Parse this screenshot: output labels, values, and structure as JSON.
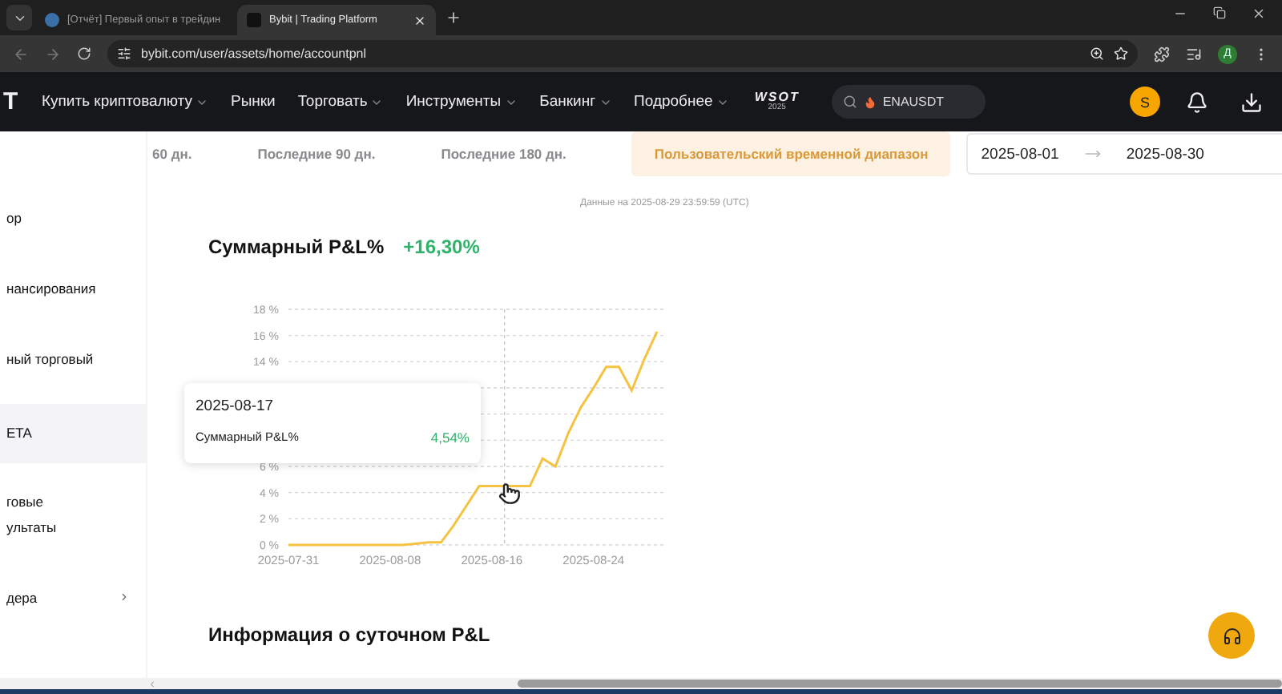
{
  "browser": {
    "tabs": [
      {
        "title": "[Отчёт] Первый опыт в трейдин",
        "selected": false
      },
      {
        "title": "Bybit | Trading Platform",
        "selected": true
      }
    ],
    "url": "bybit.com/user/assets/home/accountpnl",
    "profile_initial": "Д"
  },
  "nav": {
    "logo": "T",
    "items": [
      {
        "label": "Купить криптовалюту",
        "dropdown": true
      },
      {
        "label": "Рынки",
        "dropdown": false
      },
      {
        "label": "Торговать",
        "dropdown": true
      },
      {
        "label": "Инструменты",
        "dropdown": true
      },
      {
        "label": "Банкинг",
        "dropdown": true
      },
      {
        "label": "Подробнее",
        "dropdown": true
      }
    ],
    "event_logo": {
      "title": "WSOT",
      "year": "2025"
    },
    "search": {
      "value": "ENAUSDT"
    },
    "avatar": "S"
  },
  "sidebar": {
    "items": [
      {
        "label": "ор",
        "selected": false
      },
      {
        "label": "нансирования",
        "selected": false
      },
      {
        "label": "ный торговый",
        "selected": false
      },
      {
        "label": "ETA",
        "selected": true
      },
      {
        "label": "говые\nультаты",
        "selected": false
      },
      {
        "label": "дера",
        "selected": false,
        "chevron": true
      }
    ]
  },
  "periods": [
    {
      "label": "60 дн.",
      "selected": false
    },
    {
      "label": "Последние 90 дн.",
      "selected": false
    },
    {
      "label": "Последние 180 дн.",
      "selected": false
    },
    {
      "label": "Пользовательский временной диапазон",
      "selected": true
    }
  ],
  "date_range": {
    "start": "2025-08-01",
    "end": "2025-08-30"
  },
  "timestamp": "Данные на 2025-08-29 23:59:59 (UTC)",
  "summary": {
    "title": "Суммарный P&L%",
    "value": "+16,30%"
  },
  "chart_data": {
    "type": "line",
    "grid": true,
    "categories": [
      "2025-07-31",
      null,
      null,
      null,
      null,
      null,
      null,
      null,
      "2025-08-08",
      null,
      null,
      null,
      null,
      null,
      null,
      null,
      "2025-08-16",
      null,
      null,
      null,
      null,
      null,
      null,
      null,
      "2025-08-24",
      null,
      null,
      null,
      null,
      null
    ],
    "series": [
      {
        "color": "#f5c242",
        "values": [
          0,
          0,
          0,
          0,
          0,
          0,
          0,
          0,
          0,
          0,
          0.1,
          0.2,
          0.2,
          1.5,
          3,
          4.5,
          4.5,
          4.5,
          4.5,
          4.5,
          6.6,
          6,
          8.5,
          10.5,
          12,
          13.6,
          13.6,
          11.8,
          14.2,
          16.3
        ]
      }
    ],
    "ylim": [
      0,
      18
    ],
    "yticks": [
      {
        "value": 0,
        "label": "0 %"
      },
      {
        "value": 2,
        "label": "2 %"
      },
      {
        "value": 4,
        "label": "4 %"
      },
      {
        "value": 6,
        "label": "6 %"
      },
      {
        "value": 14,
        "label": "14 %"
      },
      {
        "value": 16,
        "label": "16 %"
      },
      {
        "value": 18,
        "label": "18 %"
      }
    ]
  },
  "tooltip": {
    "date": "2025-08-17",
    "label": "Суммарный P&L%",
    "value": "4,54%"
  },
  "section_title": "Информация о суточном P&L"
}
